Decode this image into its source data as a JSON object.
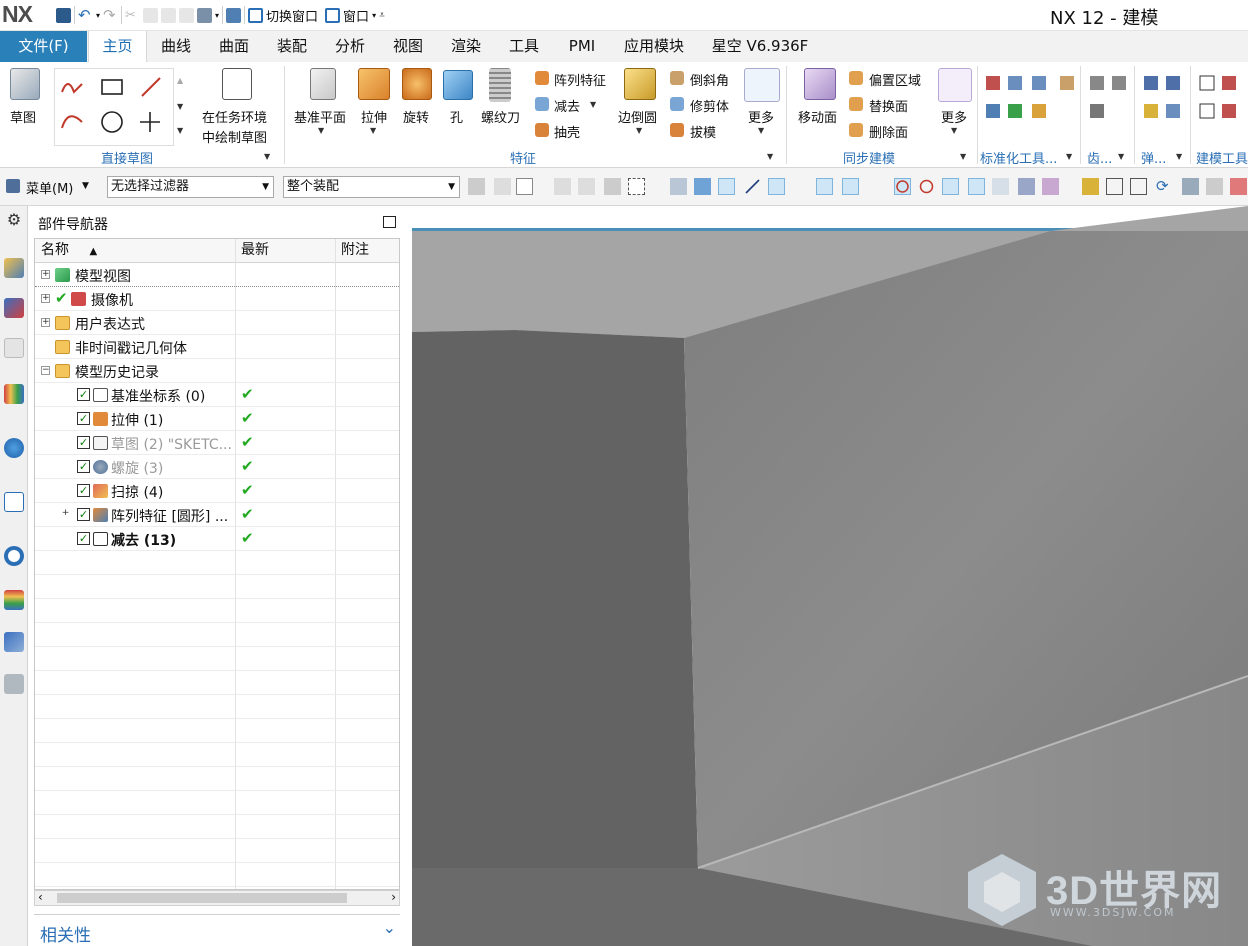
{
  "app": {
    "logo": "NX",
    "title": "NX 12 - 建模",
    "quick_access": {
      "switch_window": "切换窗口",
      "window": "窗口"
    }
  },
  "tabs": [
    {
      "label": "文件(F)"
    },
    {
      "label": "主页"
    },
    {
      "label": "曲线"
    },
    {
      "label": "曲面"
    },
    {
      "label": "装配"
    },
    {
      "label": "分析"
    },
    {
      "label": "视图"
    },
    {
      "label": "渲染"
    },
    {
      "label": "工具"
    },
    {
      "label": "PMI"
    },
    {
      "label": "应用模块"
    },
    {
      "label": "星空 V6.936F"
    }
  ],
  "ribbon": {
    "sketch": "草图",
    "task_env_line1": "在任务环境",
    "task_env_line2": "中绘制草图",
    "group_direct_sketch": "直接草图",
    "datum_plane": "基准平面",
    "extrude": "拉伸",
    "revolve": "旋转",
    "hole": "孔",
    "thread_tool": "螺纹刀",
    "pattern_feature": "阵列特征",
    "subtract": "减去",
    "shell": "抽壳",
    "edge_blend": "边倒圆",
    "chamfer": "倒斜角",
    "trim_body": "修剪体",
    "draft": "拔模",
    "more": "更多",
    "group_feature": "特征",
    "move_face": "移动面",
    "offset_region": "偏置区域",
    "replace_face": "替换面",
    "delete_face": "删除面",
    "group_sync": "同步建模",
    "group_std_tools": "标准化工具...",
    "group_gear": "齿...",
    "group_spring": "弹...",
    "group_modeling_tools": "建模工具"
  },
  "selection_bar": {
    "menu": "菜单(M)",
    "filter": "无选择过滤器",
    "scope": "整个装配"
  },
  "navigator": {
    "title": "部件导航器",
    "columns": [
      "名称",
      "最新",
      "附注"
    ],
    "rows": [
      {
        "label": "模型视图",
        "status": ""
      },
      {
        "label": "摄像机",
        "status": ""
      },
      {
        "label": "用户表达式",
        "status": ""
      },
      {
        "label": "非时间戳记几何体",
        "status": ""
      },
      {
        "label": "模型历史记录",
        "status": ""
      },
      {
        "label": "基准坐标系 (0)",
        "status": "✔"
      },
      {
        "label": "拉伸 (1)",
        "status": "✔"
      },
      {
        "label": "草图 (2) \"SKETC...",
        "status": "✔"
      },
      {
        "label": "螺旋 (3)",
        "status": "✔"
      },
      {
        "label": "扫掠 (4)",
        "status": "✔"
      },
      {
        "label": "阵列特征 [圆形] ...",
        "status": "✔"
      },
      {
        "label": "减去 (13)",
        "status": "✔"
      }
    ],
    "related": "相关性"
  },
  "watermark": {
    "text": "3D世界网",
    "sub": "WWW.3DSJW.COM"
  }
}
